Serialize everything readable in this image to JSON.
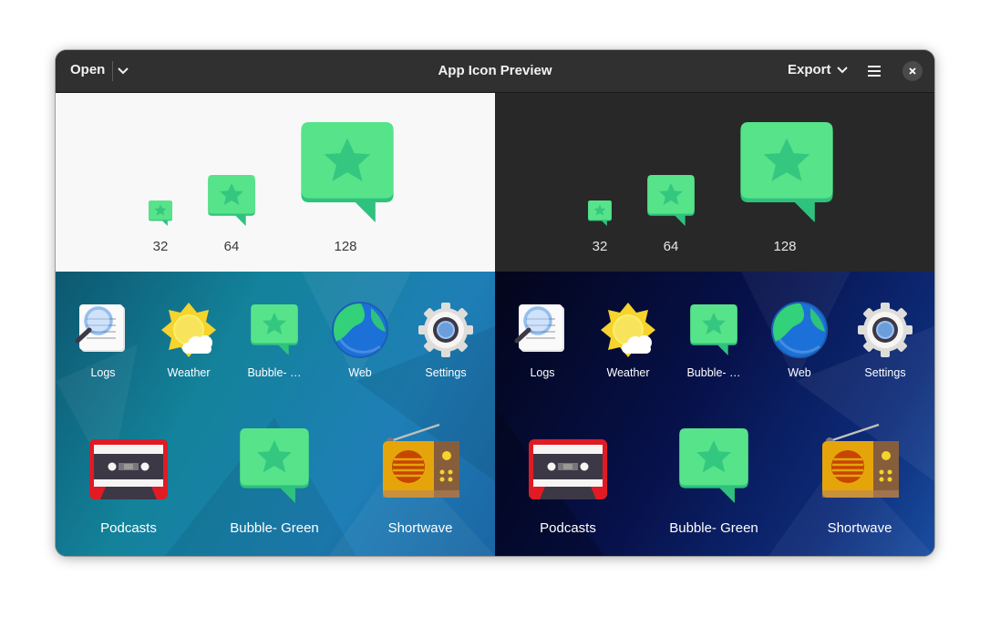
{
  "header": {
    "open_label": "Open",
    "title": "App Icon Preview",
    "export_label": "Export",
    "open_menu_icon": "chevron-down-icon",
    "export_menu_icon": "chevron-down-icon",
    "menu_icon": "hamburger-menu-icon",
    "close_icon": "close-icon"
  },
  "light_sizes": [
    "32",
    "64",
    "128"
  ],
  "dark_sizes": [
    "32",
    "64",
    "128"
  ],
  "grid_small": [
    "Logs",
    "Weather",
    "Bubble- …",
    "Web",
    "Settings"
  ],
  "grid_big": [
    "Podcasts",
    "Bubble- Green",
    "Shortwave"
  ],
  "colors": {
    "icon_green": "#57e389",
    "icon_green_dark": "#2ec27e",
    "headerbar": "#303030"
  }
}
